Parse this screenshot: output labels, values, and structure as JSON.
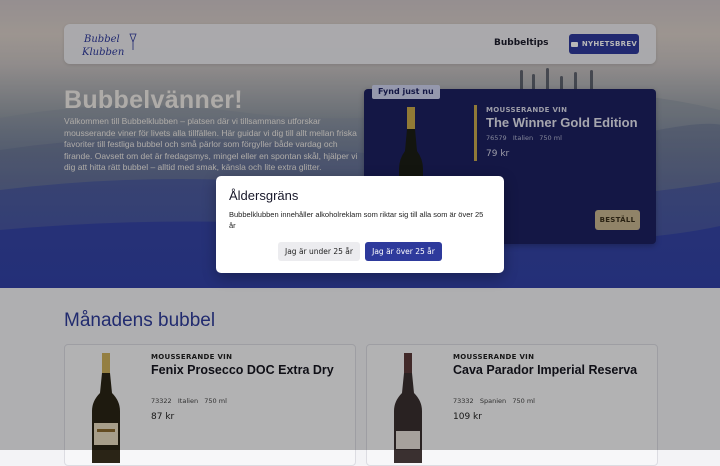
{
  "header": {
    "logo_text": "Bubbel Klubben",
    "nav_link": "Bubbeltips",
    "newsletter_label": "NYHETSBREV"
  },
  "hero": {
    "title": "Bubbelvänner!",
    "body": "Välkommen till Bubbelklubben – platsen där vi tillsammans utforskar mousserande viner för livets alla tillfällen. Här guidar vi dig till allt mellan friska favoriter till festliga bubbel och små pärlor som förgyller både vardag och firande. Oavsett om det är fredagsmys, mingel eller en spontan skål, hjälper vi dig att hitta rätt bubbel – alltid med smak, känsla och lite extra glitter."
  },
  "featured": {
    "tag": "Fynd just nu",
    "category": "MOUSSERANDE VIN",
    "name": "The Winner Gold Edition",
    "article": "76579",
    "country": "Italien",
    "volume": "750 ml",
    "price": "79 kr",
    "buy_label": "BESTÄLL"
  },
  "section": {
    "title": "Månadens bubbel",
    "products": [
      {
        "category": "MOUSSERANDE VIN",
        "name": "Fenix Prosecco DOC Extra Dry",
        "article": "73322",
        "country": "Italien",
        "volume": "750 ml",
        "price": "87 kr"
      },
      {
        "category": "MOUSSERANDE VIN",
        "name": "Cava Parador Imperial Reserva",
        "article": "73332",
        "country": "Spanien",
        "volume": "750 ml",
        "price": "109 kr"
      }
    ]
  },
  "modal": {
    "title": "Åldersgräns",
    "text": "Bubbelklubben innehåller alkoholreklam som riktar sig till alla som är över 25 år",
    "under_label": "Jag är under 25 år",
    "over_label": "Jag är över 25 år"
  },
  "colors": {
    "brand_blue": "#2e3a9c",
    "featured_bg": "#1c2160",
    "gold": "#c8a94e"
  }
}
